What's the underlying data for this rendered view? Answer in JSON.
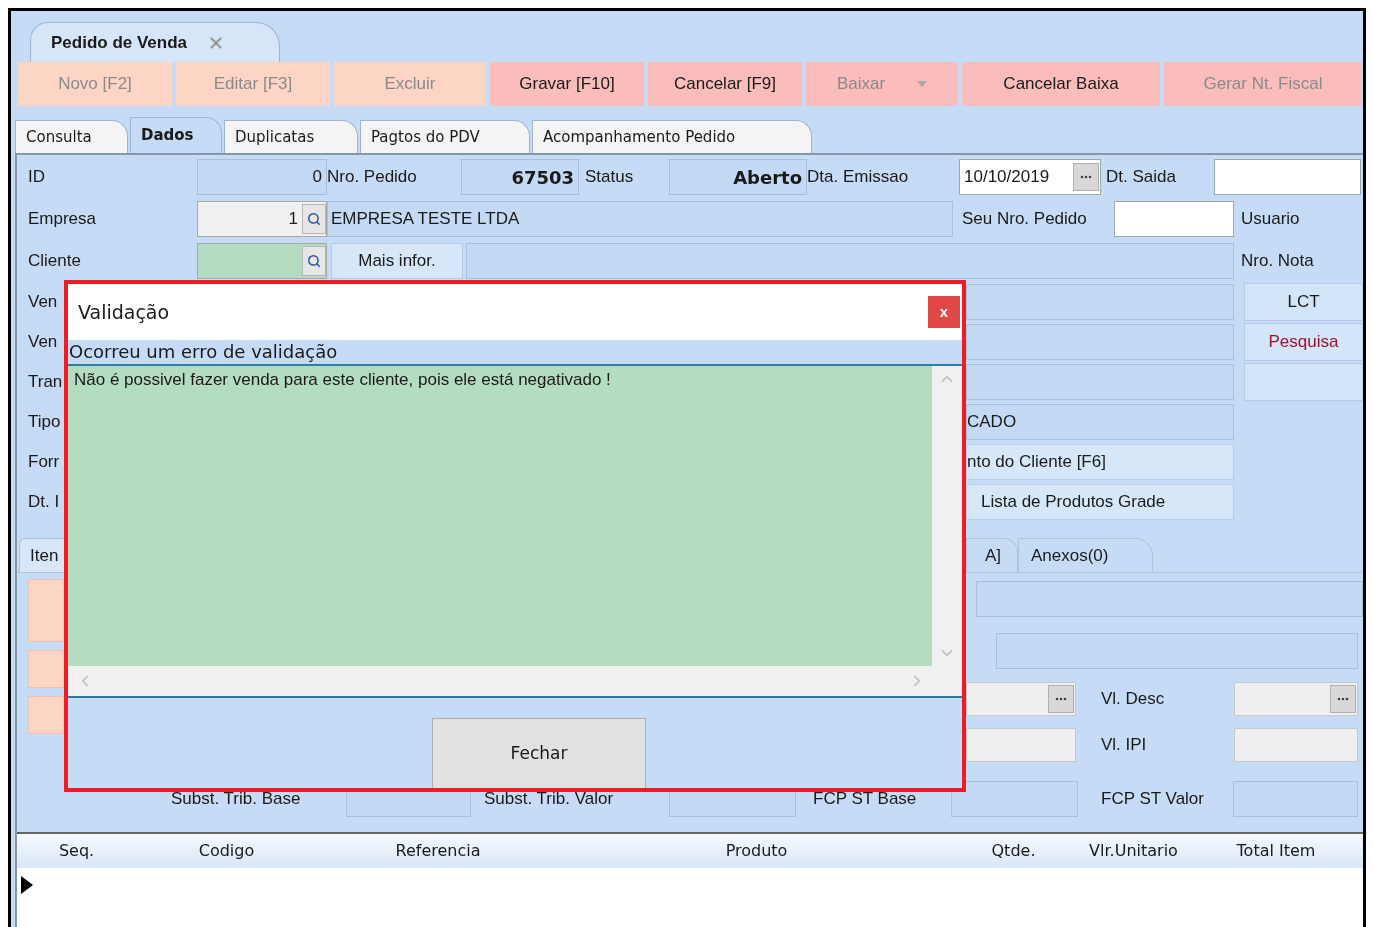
{
  "document_tab": {
    "title": "Pedido de Venda"
  },
  "toolbar": [
    {
      "label": "Novo [F2]",
      "kind": "button",
      "disabled": true,
      "color": "#fdd5c4"
    },
    {
      "label": "Editar [F3]",
      "kind": "button",
      "disabled": true,
      "color": "#fdd5c4"
    },
    {
      "label": "Excluir",
      "kind": "button",
      "disabled": true,
      "color": "#fdd5c4"
    },
    {
      "label": "Gravar [F10]",
      "kind": "button",
      "disabled": false,
      "color": "#fbbcbc"
    },
    {
      "label": "Cancelar [F9]",
      "kind": "button",
      "disabled": false,
      "color": "#fbbcbc"
    },
    {
      "label": "Baixar",
      "kind": "dropdown",
      "disabled": true,
      "color": "#fbbcbc"
    },
    {
      "label": "Cancelar Baixa",
      "kind": "button",
      "disabled": false,
      "color": "#fbbcbc"
    },
    {
      "label": "Gerar Nt. Fiscal",
      "kind": "button",
      "disabled": true,
      "color": "#fbbcbc"
    }
  ],
  "tabs": [
    {
      "label": "Consulta",
      "selected": false
    },
    {
      "label": "Dados",
      "selected": true
    },
    {
      "label": "Duplicatas",
      "selected": false
    },
    {
      "label": "Pagtos do PDV",
      "selected": false
    },
    {
      "label": "Acompanhamento Pedido",
      "selected": false
    }
  ],
  "form": {
    "id": {
      "label": "ID",
      "value": "0"
    },
    "nro_pedido": {
      "label": "Nro. Pedido",
      "value": "67503"
    },
    "status": {
      "label": "Status",
      "value": "Aberto"
    },
    "dta_emissao": {
      "label": "Dta. Emissao",
      "value": "10/10/2019"
    },
    "dt_saida": {
      "label": "Dt. Saida"
    },
    "empresa": {
      "label": "Empresa",
      "code": "1",
      "name": "EMPRESA TESTE LTDA"
    },
    "seu_nro_pedido": {
      "label": "Seu Nro. Pedido"
    },
    "usuario": {
      "label": "Usuario"
    },
    "cliente": {
      "label": "Cliente"
    },
    "mais_infor": "Mais infor.",
    "nro_nota": {
      "label": "Nro. Nota"
    },
    "partial_rows": [
      {
        "label": "Ven",
        "kind": "field"
      },
      {
        "label": "Ven",
        "kind": "field"
      },
      {
        "label": "Tran",
        "kind": "field"
      },
      {
        "label": "Tipo",
        "kind": "field",
        "value": "CADO"
      },
      {
        "label": "Forr",
        "kind": "button",
        "value": "nto do Cliente [F6]"
      },
      {
        "label": "Dt. I",
        "kind": "button",
        "value": "Lista de Produtos Grade"
      }
    ],
    "side_buttons": [
      {
        "label": "LCT",
        "kind": "plain"
      },
      {
        "label": "Pesquisa",
        "kind": "accent"
      },
      {
        "kind": "empty"
      }
    ]
  },
  "item_tabs": [
    {
      "label": "Iten",
      "selected": true
    },
    {
      "label": "A]",
      "selected": false
    },
    {
      "label": "Anexos(0)",
      "selected": false
    }
  ],
  "item_fields": {
    "vl_desc": {
      "label": "Vl. Desc"
    },
    "vl_ipi": {
      "label": "Vl. IPI"
    }
  },
  "tax_row": [
    {
      "label": "Subst. Trib. Base"
    },
    {
      "label": "Subst. Trib. Valor"
    },
    {
      "label": "FCP ST Base"
    },
    {
      "label": "FCP ST Valor"
    }
  ],
  "grid": {
    "columns": [
      "Seq.",
      "Codigo",
      "Referencia",
      "Produto",
      "Qtde.",
      "Vlr.Unitario",
      "Total Item"
    ]
  },
  "dialog": {
    "title": "Validação",
    "close": "x",
    "header": "Ocorreu um erro de validação",
    "message": "Não é possivel fazer venda para este cliente, pois ele está negativado !",
    "button": "Fechar"
  }
}
